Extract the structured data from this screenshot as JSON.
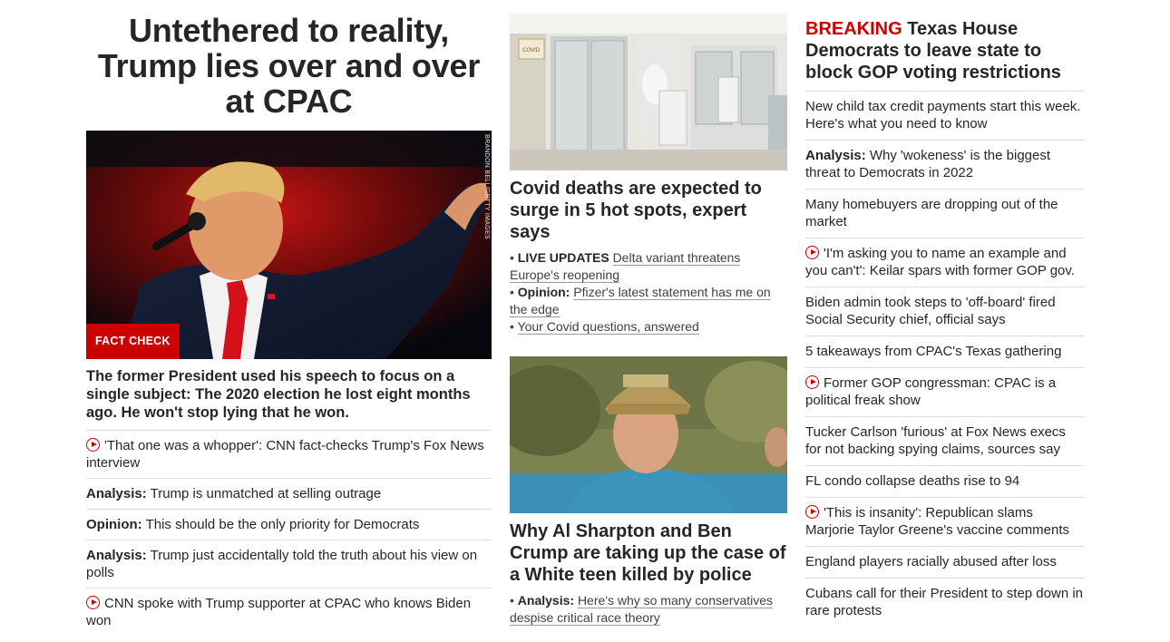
{
  "main": {
    "headline": "Untethered to reality, Trump lies over and over at CPAC",
    "image_credit": "BRANDON BELL/GETTY IMAGES",
    "badge": "FACT CHECK",
    "subhead": "The former President used his speech to focus on a single subject: The 2020 election he lost eight months ago. He won't stop lying that he won.",
    "related": [
      {
        "video": true,
        "prefix": "",
        "text": "'That one was a whopper': CNN fact-checks Trump's Fox News interview"
      },
      {
        "video": false,
        "prefix": "Analysis:",
        "text": "Trump is unmatched at selling outrage"
      },
      {
        "video": false,
        "prefix": "Opinion:",
        "text": "This should be the only priority for Democrats"
      },
      {
        "video": false,
        "prefix": "Analysis:",
        "text": "Trump just accidentally told the truth about his view on polls"
      },
      {
        "video": true,
        "prefix": "",
        "text": "CNN spoke with Trump supporter at CPAC who knows Biden won"
      }
    ]
  },
  "covid": {
    "headline": "Covid deaths are expected to surge in 5 hot spots, expert says",
    "bullets": [
      {
        "prefix": "LIVE UPDATES",
        "text": "Delta variant threatens Europe's reopening"
      },
      {
        "prefix": "Opinion:",
        "text": "Pfizer's latest statement has me on the edge"
      },
      {
        "prefix": "",
        "text": "Your Covid questions, answered"
      }
    ],
    "sign_text": "COVID"
  },
  "sharpton": {
    "headline": "Why Al Sharpton and Ben Crump are taking up the case of a White teen killed by police",
    "bullets": [
      {
        "prefix": "Analysis:",
        "text": "Here's why so many conservatives despise critical race theory"
      }
    ]
  },
  "sidebar": {
    "breaking_label": "BREAKING",
    "breaking_text": "Texas House Democrats to leave state to block GOP voting restrictions",
    "items": [
      {
        "video": false,
        "prefix": "",
        "text": "New child tax credit payments start this week. Here's what you need to know"
      },
      {
        "video": false,
        "prefix": "Analysis:",
        "text": "Why 'wokeness' is the biggest threat to Democrats in 2022"
      },
      {
        "video": false,
        "prefix": "",
        "text": "Many homebuyers are dropping out of the market"
      },
      {
        "video": true,
        "prefix": "",
        "text": "'I'm asking you to name an example and you can't': Keilar spars with former GOP gov."
      },
      {
        "video": false,
        "prefix": "",
        "text": "Biden admin took steps to 'off-board' fired Social Security chief, official says"
      },
      {
        "video": false,
        "prefix": "",
        "text": "5 takeaways from CPAC's Texas gathering"
      },
      {
        "video": true,
        "prefix": "",
        "text": "Former GOP congressman: CPAC is a political freak show"
      },
      {
        "video": false,
        "prefix": "",
        "text": "Tucker Carlson 'furious' at Fox News execs for not backing spying claims, sources say"
      },
      {
        "video": false,
        "prefix": "",
        "text": "FL condo collapse deaths rise to 94"
      },
      {
        "video": true,
        "prefix": "",
        "text": "'This is insanity': Republican slams Marjorie Taylor Greene's vaccine comments"
      },
      {
        "video": false,
        "prefix": "",
        "text": "England players racially abused after loss"
      },
      {
        "video": false,
        "prefix": "",
        "text": "Cubans call for their President to step down in rare protests"
      }
    ]
  },
  "colors": {
    "accent": "#cc0000",
    "text": "#262626",
    "divider": "#dcdcdc"
  }
}
